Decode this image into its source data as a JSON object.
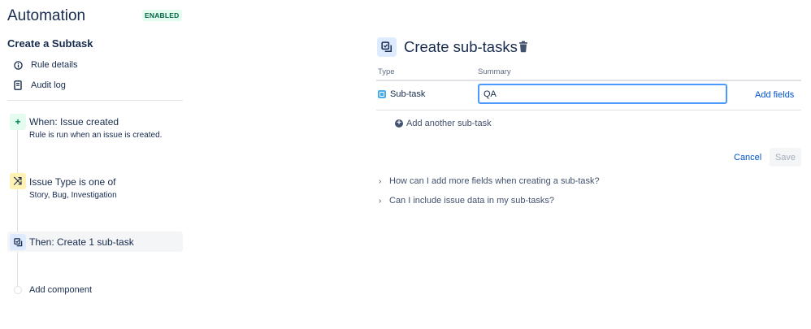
{
  "sidebar": {
    "app_title": "Automation",
    "status_badge": "ENABLED",
    "rule_name": "Create a Subtask",
    "links": [
      {
        "label": "Rule details",
        "icon": "info-icon"
      },
      {
        "label": "Audit log",
        "icon": "document-icon"
      }
    ],
    "steps": [
      {
        "title": "When: Issue created",
        "subtitle": "Rule is run when an issue is created.",
        "icon": "plus-icon",
        "icon_color": "#e3fcef",
        "glyph": "+"
      },
      {
        "title": "Issue Type is one of",
        "subtitle": "Story, Bug, Investigation",
        "icon": "shuffle-icon",
        "icon_color": "#fff0b3",
        "glyph": "⤨"
      },
      {
        "title": "Then: Create 1 sub-task",
        "subtitle": "",
        "icon": "subtask-icon",
        "icon_color": "#deebff",
        "selected": true
      }
    ],
    "add_component": "Add component"
  },
  "panel": {
    "title": "Create sub-tasks",
    "columns": {
      "type": "Type",
      "summary": "Summary"
    },
    "row": {
      "type": "Sub-task",
      "summary_value": "QA"
    },
    "add_fields": "Add fields",
    "add_another": "Add another sub-task",
    "cancel": "Cancel",
    "save": "Save",
    "faqs": [
      "How can I add more fields when creating a sub-task?",
      "Can I include issue data in my sub-tasks?"
    ]
  },
  "colors": {
    "accent": "#0052cc",
    "text": "#172b4d",
    "badge_bg": "#e3fcef",
    "badge_text": "#006644",
    "focus": "#4c9aff"
  }
}
